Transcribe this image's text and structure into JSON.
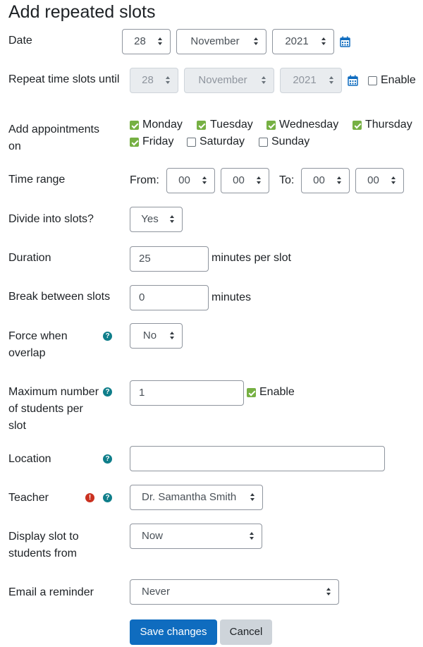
{
  "page": {
    "title": "Add repeated slots"
  },
  "labels": {
    "date": "Date",
    "repeat_until": "Repeat time slots until",
    "add_appointments": "Add appointments on",
    "time_range": "Time range",
    "divide": "Divide into slots?",
    "duration": "Duration",
    "break": "Break between slots",
    "force": "Force when overlap",
    "max_students": "Maximum number of students per slot",
    "location": "Location",
    "teacher": "Teacher",
    "display_from": "Display slot to students from",
    "email_reminder": "Email a reminder"
  },
  "date": {
    "day": "28",
    "month": "November",
    "year": "2021"
  },
  "repeat_until": {
    "day": "28",
    "month": "November",
    "year": "2021",
    "enable_label": "Enable",
    "enabled": false
  },
  "days": [
    {
      "label": "Monday",
      "checked": true
    },
    {
      "label": "Tuesday",
      "checked": true
    },
    {
      "label": "Wednesday",
      "checked": true
    },
    {
      "label": "Thursday",
      "checked": true
    },
    {
      "label": "Friday",
      "checked": true
    },
    {
      "label": "Saturday",
      "checked": false
    },
    {
      "label": "Sunday",
      "checked": false
    }
  ],
  "time_range": {
    "from_label": "From:",
    "from_hour": "00",
    "from_min": "00",
    "to_label": "To:",
    "to_hour": "00",
    "to_min": "00"
  },
  "divide": {
    "value": "Yes"
  },
  "duration": {
    "value": "25",
    "suffix": "minutes per slot"
  },
  "break": {
    "value": "0",
    "suffix": "minutes"
  },
  "force": {
    "value": "No"
  },
  "max_students": {
    "value": "1",
    "enable_label": "Enable",
    "enabled": true
  },
  "location": {
    "value": ""
  },
  "teacher": {
    "value": "Dr. Samantha Smith"
  },
  "display_from": {
    "value": "Now"
  },
  "email_reminder": {
    "value": "Never"
  },
  "buttons": {
    "save": "Save changes",
    "cancel": "Cancel"
  },
  "colors": {
    "primary": "#0f6cbf",
    "check": "#76b043",
    "help": "#0f7e8a",
    "required": "#ca3120"
  }
}
